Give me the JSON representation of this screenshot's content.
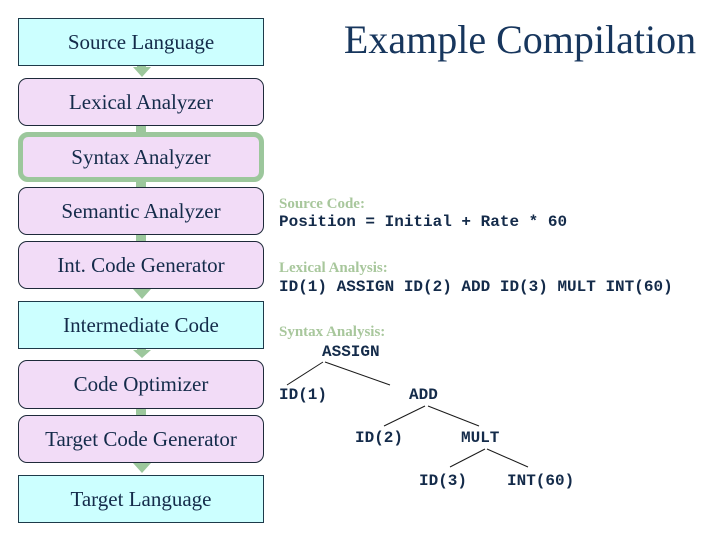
{
  "title": "Example Compilation",
  "pipeline": [
    {
      "label": "Source Language",
      "kind": "language"
    },
    {
      "label": "Lexical Analyzer",
      "kind": "phase"
    },
    {
      "label": "Syntax Analyzer",
      "kind": "phase",
      "highlighted": true
    },
    {
      "label": "Semantic Analyzer",
      "kind": "phase"
    },
    {
      "label": "Int. Code Generator",
      "kind": "phase"
    },
    {
      "label": "Intermediate Code",
      "kind": "language"
    },
    {
      "label": "Code Optimizer",
      "kind": "phase"
    },
    {
      "label": "Target Code Generator",
      "kind": "phase"
    },
    {
      "label": "Target Language",
      "kind": "language"
    }
  ],
  "example": {
    "source": {
      "label": "Source Code:",
      "code": "Position = Initial + Rate * 60"
    },
    "lexical": {
      "label": "Lexical Analysis:",
      "code": "ID(1) ASSIGN ID(2) ADD ID(3) MULT INT(60)"
    },
    "syntax": {
      "label": "Syntax Analysis:",
      "tree": {
        "root": "ASSIGN",
        "assign_left": "ID(1)",
        "assign_right": "ADD",
        "add_left": "ID(2)",
        "add_right": "MULT",
        "mult_left": "ID(3)",
        "mult_right": "INT(60)"
      }
    }
  },
  "colors": {
    "language_box": "#ccffff",
    "phase_box": "#f2dcf7",
    "connector": "#9cc79c",
    "label": "#a8c79c",
    "text": "#142b4a"
  }
}
